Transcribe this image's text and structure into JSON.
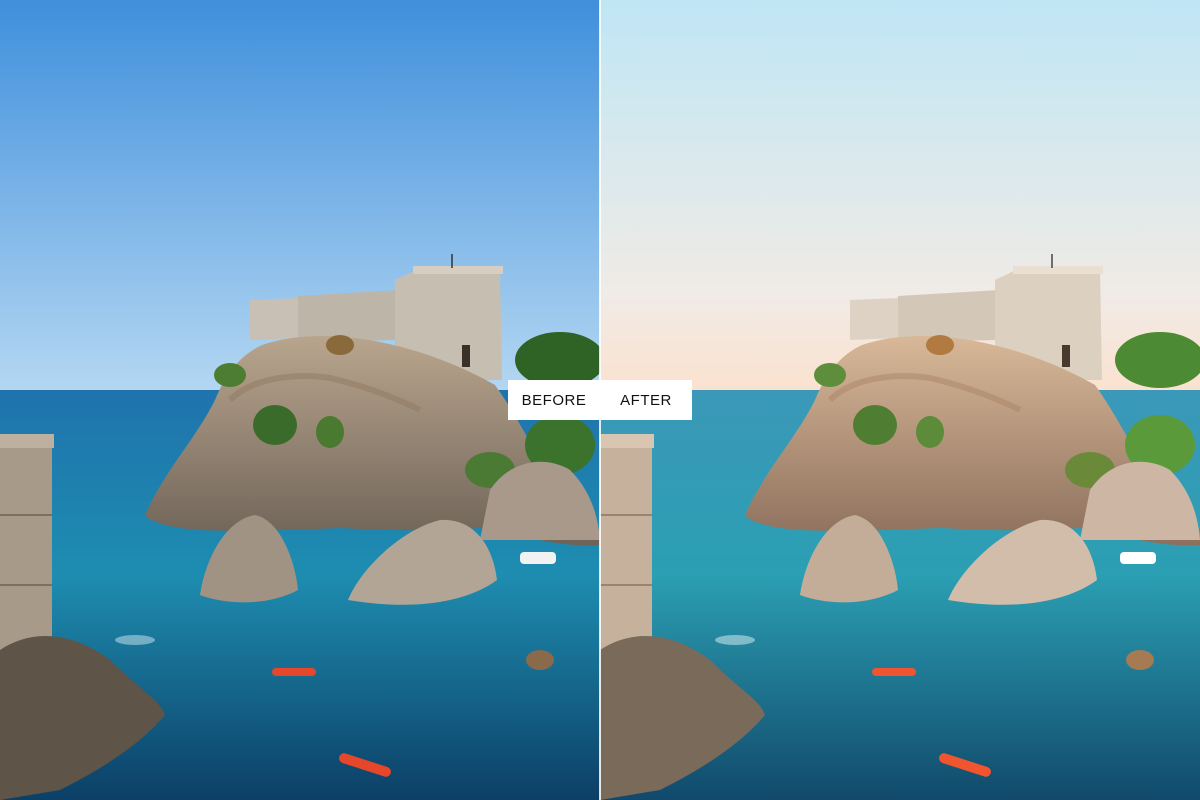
{
  "labels": {
    "before": "BEFORE",
    "after": "AFTER"
  },
  "colors": {
    "before_sky_top": "#3f8fdc",
    "before_sky_bottom": "#aed3f2",
    "after_sky_top": "#bfe6f5",
    "after_sky_bottom": "#fbe6d6",
    "sea": "#1f7fa6",
    "label_bg": "#ffffff",
    "label_text": "#111111"
  }
}
